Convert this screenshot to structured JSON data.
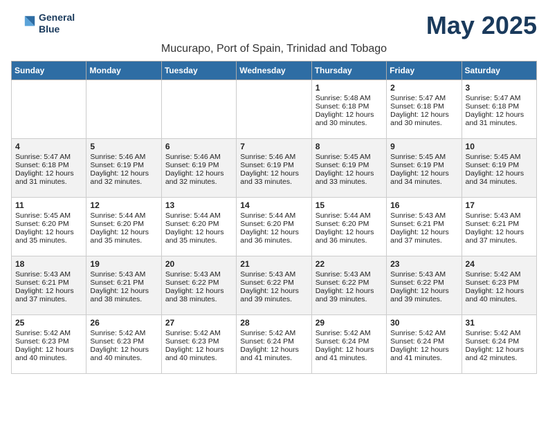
{
  "header": {
    "logo_line1": "General",
    "logo_line2": "Blue",
    "month_title": "May 2025",
    "location": "Mucurapo, Port of Spain, Trinidad and Tobago"
  },
  "weekdays": [
    "Sunday",
    "Monday",
    "Tuesday",
    "Wednesday",
    "Thursday",
    "Friday",
    "Saturday"
  ],
  "weeks": [
    [
      {
        "day": "",
        "empty": true
      },
      {
        "day": "",
        "empty": true
      },
      {
        "day": "",
        "empty": true
      },
      {
        "day": "",
        "empty": true
      },
      {
        "day": "1",
        "sunrise": "5:48 AM",
        "sunset": "6:18 PM",
        "daylight": "12 hours and 30 minutes."
      },
      {
        "day": "2",
        "sunrise": "5:47 AM",
        "sunset": "6:18 PM",
        "daylight": "12 hours and 30 minutes."
      },
      {
        "day": "3",
        "sunrise": "5:47 AM",
        "sunset": "6:18 PM",
        "daylight": "12 hours and 31 minutes."
      }
    ],
    [
      {
        "day": "4",
        "sunrise": "5:47 AM",
        "sunset": "6:18 PM",
        "daylight": "12 hours and 31 minutes."
      },
      {
        "day": "5",
        "sunrise": "5:46 AM",
        "sunset": "6:19 PM",
        "daylight": "12 hours and 32 minutes."
      },
      {
        "day": "6",
        "sunrise": "5:46 AM",
        "sunset": "6:19 PM",
        "daylight": "12 hours and 32 minutes."
      },
      {
        "day": "7",
        "sunrise": "5:46 AM",
        "sunset": "6:19 PM",
        "daylight": "12 hours and 33 minutes."
      },
      {
        "day": "8",
        "sunrise": "5:45 AM",
        "sunset": "6:19 PM",
        "daylight": "12 hours and 33 minutes."
      },
      {
        "day": "9",
        "sunrise": "5:45 AM",
        "sunset": "6:19 PM",
        "daylight": "12 hours and 34 minutes."
      },
      {
        "day": "10",
        "sunrise": "5:45 AM",
        "sunset": "6:19 PM",
        "daylight": "12 hours and 34 minutes."
      }
    ],
    [
      {
        "day": "11",
        "sunrise": "5:45 AM",
        "sunset": "6:20 PM",
        "daylight": "12 hours and 35 minutes."
      },
      {
        "day": "12",
        "sunrise": "5:44 AM",
        "sunset": "6:20 PM",
        "daylight": "12 hours and 35 minutes."
      },
      {
        "day": "13",
        "sunrise": "5:44 AM",
        "sunset": "6:20 PM",
        "daylight": "12 hours and 35 minutes."
      },
      {
        "day": "14",
        "sunrise": "5:44 AM",
        "sunset": "6:20 PM",
        "daylight": "12 hours and 36 minutes."
      },
      {
        "day": "15",
        "sunrise": "5:44 AM",
        "sunset": "6:20 PM",
        "daylight": "12 hours and 36 minutes."
      },
      {
        "day": "16",
        "sunrise": "5:43 AM",
        "sunset": "6:21 PM",
        "daylight": "12 hours and 37 minutes."
      },
      {
        "day": "17",
        "sunrise": "5:43 AM",
        "sunset": "6:21 PM",
        "daylight": "12 hours and 37 minutes."
      }
    ],
    [
      {
        "day": "18",
        "sunrise": "5:43 AM",
        "sunset": "6:21 PM",
        "daylight": "12 hours and 37 minutes."
      },
      {
        "day": "19",
        "sunrise": "5:43 AM",
        "sunset": "6:21 PM",
        "daylight": "12 hours and 38 minutes."
      },
      {
        "day": "20",
        "sunrise": "5:43 AM",
        "sunset": "6:22 PM",
        "daylight": "12 hours and 38 minutes."
      },
      {
        "day": "21",
        "sunrise": "5:43 AM",
        "sunset": "6:22 PM",
        "daylight": "12 hours and 39 minutes."
      },
      {
        "day": "22",
        "sunrise": "5:43 AM",
        "sunset": "6:22 PM",
        "daylight": "12 hours and 39 minutes."
      },
      {
        "day": "23",
        "sunrise": "5:43 AM",
        "sunset": "6:22 PM",
        "daylight": "12 hours and 39 minutes."
      },
      {
        "day": "24",
        "sunrise": "5:42 AM",
        "sunset": "6:23 PM",
        "daylight": "12 hours and 40 minutes."
      }
    ],
    [
      {
        "day": "25",
        "sunrise": "5:42 AM",
        "sunset": "6:23 PM",
        "daylight": "12 hours and 40 minutes."
      },
      {
        "day": "26",
        "sunrise": "5:42 AM",
        "sunset": "6:23 PM",
        "daylight": "12 hours and 40 minutes."
      },
      {
        "day": "27",
        "sunrise": "5:42 AM",
        "sunset": "6:23 PM",
        "daylight": "12 hours and 40 minutes."
      },
      {
        "day": "28",
        "sunrise": "5:42 AM",
        "sunset": "6:24 PM",
        "daylight": "12 hours and 41 minutes."
      },
      {
        "day": "29",
        "sunrise": "5:42 AM",
        "sunset": "6:24 PM",
        "daylight": "12 hours and 41 minutes."
      },
      {
        "day": "30",
        "sunrise": "5:42 AM",
        "sunset": "6:24 PM",
        "daylight": "12 hours and 41 minutes."
      },
      {
        "day": "31",
        "sunrise": "5:42 AM",
        "sunset": "6:24 PM",
        "daylight": "12 hours and 42 minutes."
      }
    ]
  ]
}
